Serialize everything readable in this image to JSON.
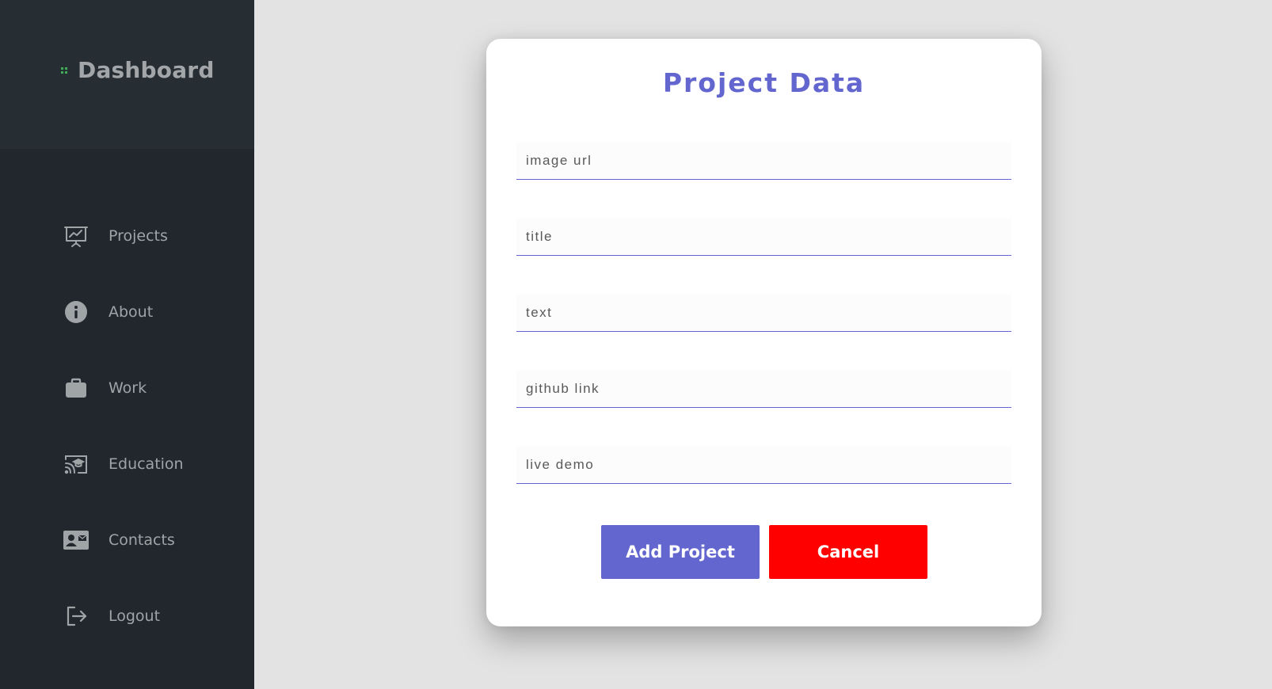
{
  "sidebar": {
    "brand": {
      "title": "Dashboard",
      "icon": "grid-dots-icon",
      "icon_color": "#3fae57"
    },
    "items": [
      {
        "label": "Projects",
        "icon": "presentation-chart-icon"
      },
      {
        "label": "About",
        "icon": "info-circle-icon"
      },
      {
        "label": "Work",
        "icon": "briefcase-icon"
      },
      {
        "label": "Education",
        "icon": "cast-education-icon"
      },
      {
        "label": "Contacts",
        "icon": "contact-card-icon"
      },
      {
        "label": "Logout",
        "icon": "logout-icon"
      }
    ]
  },
  "modal": {
    "title": "Project Data",
    "fields": [
      {
        "placeholder": "image url",
        "value": ""
      },
      {
        "placeholder": "title",
        "value": ""
      },
      {
        "placeholder": "text",
        "value": ""
      },
      {
        "placeholder": "github link",
        "value": ""
      },
      {
        "placeholder": "live demo",
        "value": ""
      }
    ],
    "add_label": "Add Project",
    "cancel_label": "Cancel"
  },
  "colors": {
    "accent": "#6366cf",
    "danger": "#ff0000",
    "sidebar_bg": "#21272d",
    "sidebar_head_bg": "#262e34",
    "page_bg": "#e3e3e3"
  }
}
